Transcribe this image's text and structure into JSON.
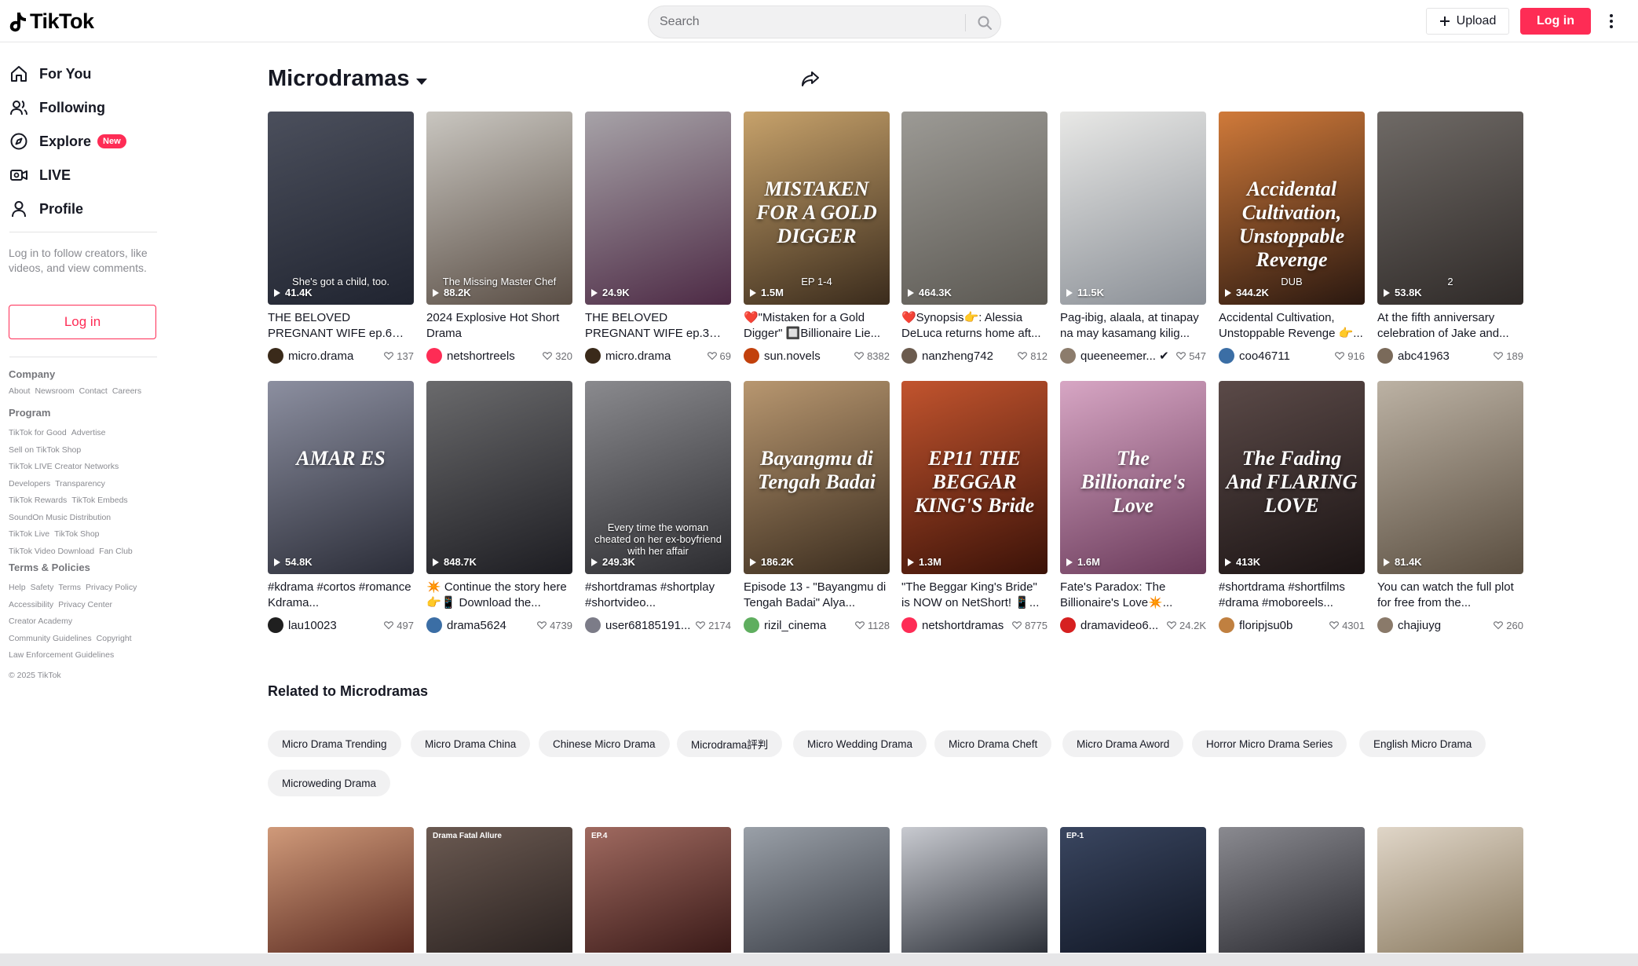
{
  "header": {
    "logo_text": "TikTok",
    "search_placeholder": "Search",
    "upload_label": "Upload",
    "login_label": "Log in",
    "accent_color": "#fe2c55"
  },
  "sidebar": {
    "nav": [
      {
        "label": "For You",
        "icon": "home-icon"
      },
      {
        "label": "Following",
        "icon": "following-icon"
      },
      {
        "label": "Explore",
        "icon": "explore-icon",
        "badge": "New"
      },
      {
        "label": "LIVE",
        "icon": "live-icon"
      },
      {
        "label": "Profile",
        "icon": "profile-icon"
      }
    ],
    "login_note": "Log in to follow creators, like videos, and view comments.",
    "login_button": "Log in",
    "footer": {
      "company_head": "Company",
      "company_links": [
        "About",
        "Newsroom",
        "Contact",
        "Careers"
      ],
      "program_head": "Program",
      "program_links": [
        [
          "TikTok for Good",
          "Advertise"
        ],
        [
          "Sell on TikTok Shop"
        ],
        [
          "TikTok LIVE Creator Networks"
        ],
        [
          "Developers",
          "Transparency"
        ],
        [
          "TikTok Rewards",
          "TikTok Embeds"
        ],
        [
          "SoundOn Music Distribution"
        ],
        [
          "TikTok Live",
          "TikTok Shop"
        ],
        [
          "TikTok Video Download",
          "Fan Club"
        ]
      ],
      "terms_head": "Terms & Policies",
      "terms_links": [
        [
          "Help",
          "Safety",
          "Terms",
          "Privacy Policy"
        ],
        [
          "Accessibility",
          "Privacy Center"
        ],
        [
          "Creator Academy"
        ],
        [
          "Community Guidelines",
          "Copyright"
        ],
        [
          "Law Enforcement Guidelines"
        ]
      ],
      "copyright": "© 2025 TikTok"
    }
  },
  "main": {
    "title": "Microdramas",
    "videos": [
      {
        "views": "41.4K",
        "desc": "THE BELOVED PREGNANT WIFE ep.6 #shorts...",
        "user": "micro.drama",
        "likes": "137",
        "caption": "",
        "sub": "She's got a child, too.",
        "bg": [
          "#4b4f5c",
          "#202430"
        ],
        "avatar": "#3a2a1a"
      },
      {
        "views": "88.2K",
        "desc": "2024 Explosive Hot Short Drama",
        "user": "netshortreels",
        "likes": "320",
        "caption": "",
        "sub": "The Missing Master Chef",
        "bg": [
          "#c9c6c0",
          "#5a4e45"
        ],
        "avatar": "#fe2c55"
      },
      {
        "views": "24.9K",
        "desc": "THE BELOVED PREGNANT WIFE ep.3 #shorts...",
        "user": "micro.drama",
        "likes": "69",
        "caption": "",
        "sub": "",
        "bg": [
          "#a7a3a8",
          "#4d2a45"
        ],
        "avatar": "#3a2a1a"
      },
      {
        "views": "1.5M",
        "desc": "❤️\"Mistaken for a Gold Digger\" 🔲Billionaire Lie...",
        "user": "sun.novels",
        "likes": "8382",
        "caption": "MISTAKEN FOR A GOLD DIGGER",
        "sub": "EP 1-4",
        "bg": [
          "#c7a26b",
          "#3a2b1c"
        ],
        "avatar": "#c2410c"
      },
      {
        "views": "464.3K",
        "desc": "❤️Synopsis👉: Alessia DeLuca returns home aft...",
        "user": "nanzheng742",
        "likes": "812",
        "caption": "",
        "sub": "",
        "bg": [
          "#9c9a95",
          "#5b5852"
        ],
        "avatar": "#6b5b4e"
      },
      {
        "views": "11.5K",
        "desc": "Pag-ibig, alaala, at tinapay na may kasamang kilig...",
        "user": "queeneemer... ✔",
        "likes": "547",
        "caption": "",
        "sub": "",
        "bg": [
          "#e8e8e6",
          "#8a8f96"
        ],
        "avatar": "#8c7c6c"
      },
      {
        "views": "344.2K",
        "desc": "Accidental Cultivation, Unstoppable Revenge 👉...",
        "user": "coo46711",
        "likes": "916",
        "caption": "Accidental Cultivation, Unstoppable Revenge",
        "sub": "DUB",
        "bg": [
          "#d07a3a",
          "#2a1810"
        ],
        "avatar": "#3b6ea5"
      },
      {
        "views": "53.8K",
        "desc": "At the fifth anniversary celebration of Jake and...",
        "user": "abc41963",
        "likes": "189",
        "caption": "",
        "sub": "2",
        "bg": [
          "#6f6a66",
          "#2f2a28"
        ],
        "avatar": "#7a6a5a"
      },
      {
        "views": "54.8K",
        "desc": "#kdrama #cortos #romance Kdrama...",
        "user": "lau10023",
        "likes": "497",
        "caption": "AMAR ES",
        "sub": "",
        "bg": [
          "#8c8fa0",
          "#2b2d38"
        ],
        "avatar": "#1f1f1f"
      },
      {
        "views": "848.7K",
        "desc": "✴️ Continue the story here 👉📱 Download the...",
        "user": "drama5624",
        "likes": "4739",
        "caption": "",
        "sub": "",
        "bg": [
          "#6a6a6c",
          "#1d1d22"
        ],
        "avatar": "#3b6ea5"
      },
      {
        "views": "249.3K",
        "desc": "#shortdramas #shortplay #shortvideo...",
        "user": "user68185191...",
        "likes": "2174",
        "caption": "",
        "sub": "Every time the woman cheated on her ex-boyfriend with her affair",
        "bg": [
          "#8a8a8e",
          "#2c2c30"
        ],
        "avatar": "#7c7c88"
      },
      {
        "views": "186.2K",
        "desc": "Episode 13 - \"Bayangmu di Tengah Badai\" Alya...",
        "user": "rizil_cinema",
        "likes": "1128",
        "caption": "Bayangmu di Tengah Badai",
        "sub": "",
        "bg": [
          "#b89770",
          "#3a2c1e"
        ],
        "avatar": "#5fae5f"
      },
      {
        "views": "1.3M",
        "desc": "\"The Beggar King's Bride\" is NOW on NetShort! 📱...",
        "user": "netshortdramas",
        "likes": "8775",
        "caption": "EP11 THE BEGGAR KING'S Bride",
        "sub": "",
        "bg": [
          "#c2542e",
          "#3b1208"
        ],
        "avatar": "#fe2c55"
      },
      {
        "views": "1.6M",
        "desc": "Fate's Paradox: The Billionaire's Love✴️...",
        "user": "dramavideo6...",
        "likes": "24.2K",
        "caption": "The Billionaire's Love",
        "sub": "",
        "bg": [
          "#d7a6c4",
          "#6a3a5a"
        ],
        "avatar": "#d62020"
      },
      {
        "views": "413K",
        "desc": "#shortdrama #shortfilms #drama #moboreels...",
        "user": "floripjsu0b",
        "likes": "4301",
        "caption": "The Fading And FLARING LOVE",
        "sub": "",
        "bg": [
          "#5b4a48",
          "#1b1414"
        ],
        "avatar": "#c08040"
      },
      {
        "views": "81.4K",
        "desc": "You can watch the full plot for free from the...",
        "user": "chajiuyg",
        "likes": "260",
        "caption": "",
        "sub": "",
        "bg": [
          "#bcb2a4",
          "#5a4e40"
        ],
        "avatar": "#8a7a6a"
      }
    ],
    "related_title": "Related to Microdramas",
    "related_chips": [
      "Micro Drama Trending",
      "Micro Drama China",
      "Chinese Micro Drama",
      "Microdrama評判",
      "Micro Wedding Drama",
      "Micro Drama Cheft",
      "Micro Drama Aword",
      "Horror Micro Drama Series",
      "English Micro Drama",
      "Microweding Drama"
    ],
    "more_thumbs": [
      {
        "bg": [
          "#d09a7a",
          "#5a2a20"
        ],
        "label": ""
      },
      {
        "bg": [
          "#6b5a52",
          "#2a2220"
        ],
        "label": "Drama Fatal Allure"
      },
      {
        "bg": [
          "#a06a60",
          "#3a1a18"
        ],
        "label": "EP.4"
      },
      {
        "bg": [
          "#9aa0a8",
          "#3a3e46"
        ],
        "label": ""
      },
      {
        "bg": [
          "#c8cad0",
          "#2c3038"
        ],
        "label": ""
      },
      {
        "bg": [
          "#3a4660",
          "#101624"
        ],
        "label": "EP-1"
      },
      {
        "bg": [
          "#8a8a90",
          "#2a2a30"
        ],
        "label": ""
      },
      {
        "bg": [
          "#e0d6c8",
          "#8a7a60"
        ],
        "label": ""
      }
    ]
  }
}
